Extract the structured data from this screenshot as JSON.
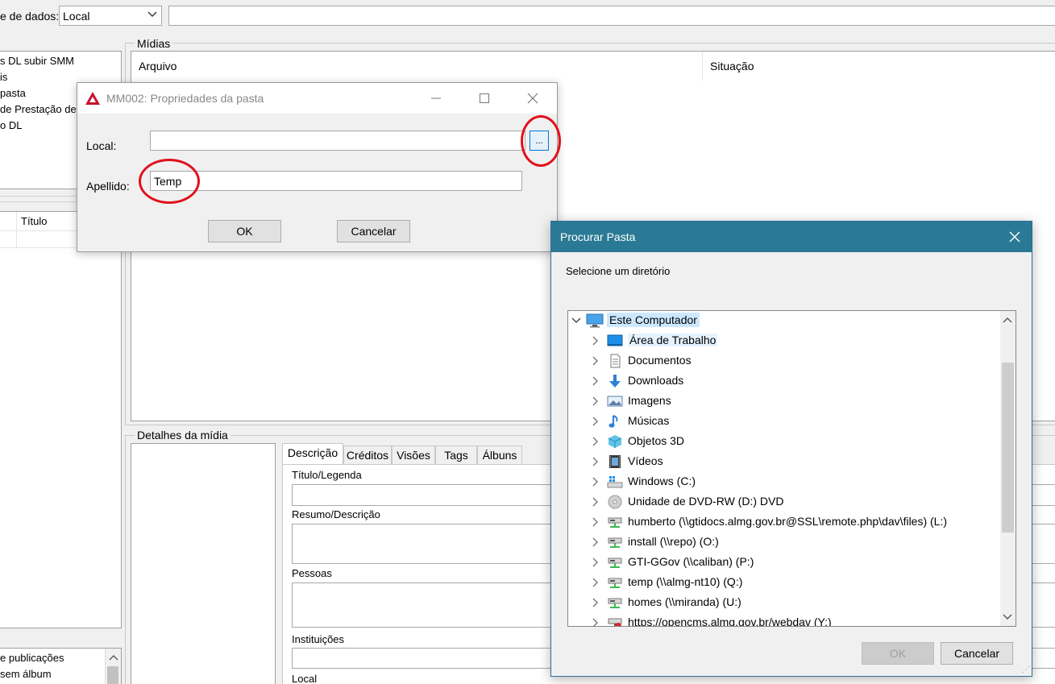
{
  "toolbar": {
    "source_label": "e de dados:",
    "source_value": "Local",
    "search_value": ""
  },
  "left_list": {
    "items": [
      "s DL subir SMM",
      "is",
      "pasta",
      "de Prestação de",
      "o DL"
    ],
    "header_col": "Título",
    "bottom_items": [
      "e publicações",
      "sem álbum"
    ]
  },
  "midias": {
    "group_label": "Mídias",
    "col_arquivo": "Arquivo",
    "col_situacao": "Situação"
  },
  "detalhes": {
    "group_label": "Detalhes da mídia",
    "tabs": [
      "Descrição",
      "Créditos",
      "Visões",
      "Tags",
      "Álbuns"
    ],
    "fields": [
      "Título/Legenda",
      "Resumo/Descrição",
      "Pessoas",
      "Instituições",
      "Local"
    ]
  },
  "props_dialog": {
    "title": "MM002: Propriedades da pasta",
    "local_label": "Local:",
    "local_value": "",
    "browse_label": "...",
    "apellido_label": "Apellido:",
    "apellido_value": "Temp",
    "ok_label": "OK",
    "cancel_label": "Cancelar"
  },
  "browse_dialog": {
    "title": "Procurar Pasta",
    "prompt": "Selecione um diretório",
    "root": "Este Computador",
    "items": [
      {
        "label": "Área de Trabalho",
        "icon": "desktop-icon"
      },
      {
        "label": "Documentos",
        "icon": "documents-icon"
      },
      {
        "label": "Downloads",
        "icon": "downloads-icon"
      },
      {
        "label": "Imagens",
        "icon": "pictures-icon"
      },
      {
        "label": "Músicas",
        "icon": "music-icon"
      },
      {
        "label": "Objetos 3D",
        "icon": "objects3d-icon"
      },
      {
        "label": "Vídeos",
        "icon": "videos-icon"
      },
      {
        "label": "Windows (C:)",
        "icon": "windows-drive-icon"
      },
      {
        "label": "Unidade de DVD-RW (D:) DVD",
        "icon": "dvd-drive-icon"
      },
      {
        "label": "humberto (\\\\gtidocs.almg.gov.br@SSL\\remote.php\\dav\\files) (L:)",
        "icon": "network-drive-icon"
      },
      {
        "label": "install (\\\\repo) (O:)",
        "icon": "network-drive-icon"
      },
      {
        "label": "GTI-GGov (\\\\caliban) (P:)",
        "icon": "network-drive-icon"
      },
      {
        "label": "temp (\\\\almg-nt10) (Q:)",
        "icon": "network-drive-icon"
      },
      {
        "label": "homes (\\\\miranda) (U:)",
        "icon": "network-drive-icon"
      },
      {
        "label": "https://opencms.almg.gov.br/webdav (Y:)",
        "icon": "network-drive-disconnected-icon"
      }
    ],
    "ok_label": "OK",
    "cancel_label": "Cancelar"
  }
}
